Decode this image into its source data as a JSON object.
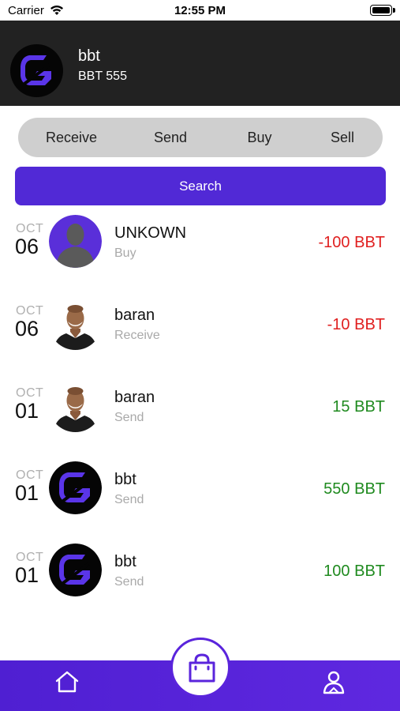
{
  "status_bar": {
    "carrier": "Carrier",
    "time": "12:55 PM"
  },
  "header": {
    "name": "bbt",
    "subtitle": "BBT 555"
  },
  "actions": [
    "Receive",
    "Send",
    "Buy",
    "Sell"
  ],
  "search": {
    "label": "Search"
  },
  "transactions": [
    {
      "month": "OCT",
      "day": "06",
      "name": "UNKOWN",
      "type": "Buy",
      "amount": "-100 BBT",
      "direction": "negative",
      "avatar": "placeholder-person-icon"
    },
    {
      "month": "OCT",
      "day": "06",
      "name": "baran",
      "type": "Receive",
      "amount": "-10 BBT",
      "direction": "negative",
      "avatar": "person-photo"
    },
    {
      "month": "OCT",
      "day": "01",
      "name": "baran",
      "type": "Send",
      "amount": "15 BBT",
      "direction": "positive",
      "avatar": "person-photo"
    },
    {
      "month": "OCT",
      "day": "01",
      "name": "bbt",
      "type": "Send",
      "amount": "550 BBT",
      "direction": "positive",
      "avatar": "bbt-logo"
    },
    {
      "month": "OCT",
      "day": "01",
      "name": "bbt",
      "type": "Send",
      "amount": "100 BBT",
      "direction": "positive",
      "avatar": "bbt-logo"
    }
  ],
  "nav": {
    "home": "home-icon",
    "center": "shopping-bag-icon",
    "profile": "profile-icon"
  },
  "colors": {
    "primary": "#5129d6",
    "header_bg": "#222222",
    "negative": "#e02020",
    "positive": "#1f8a1f"
  }
}
